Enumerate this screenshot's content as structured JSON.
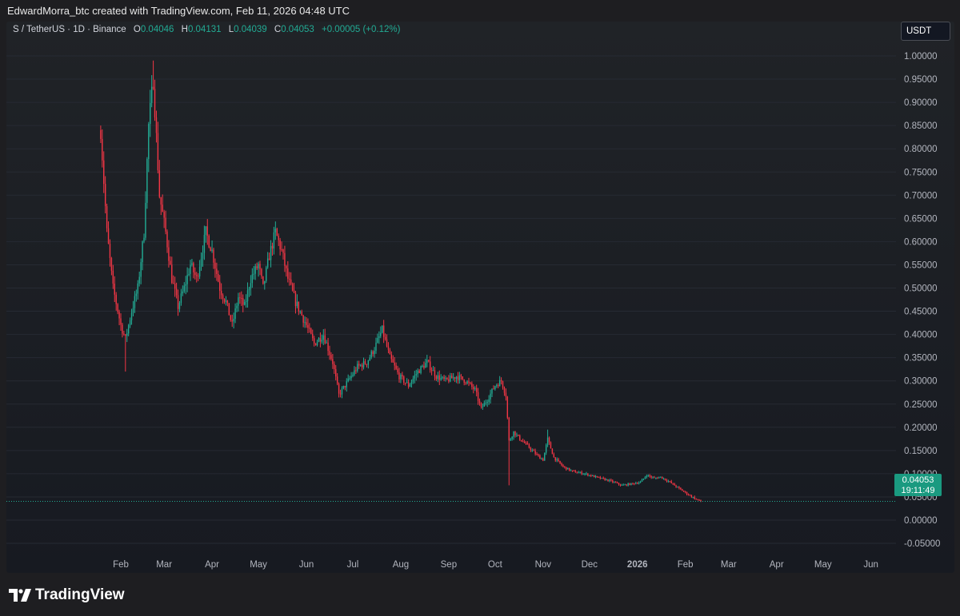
{
  "header": {
    "attribution": "EdwardMorra_btc created with TradingView.com, Feb 11, 2026 04:48 UTC"
  },
  "legend": {
    "symbol": "S / TetherUS · 1D · Binance",
    "open_label": "O",
    "open": "0.04046",
    "high_label": "H",
    "high": "0.04131",
    "low_label": "L",
    "low": "0.04039",
    "close_label": "C",
    "close": "0.04053",
    "change": "+0.00005 (+0.12%)"
  },
  "currency": "USDT",
  "last_price": {
    "price": "0.04053",
    "countdown": "19:11:49"
  },
  "footer": {
    "brand": "TradingView"
  },
  "colors": {
    "up": "#22ab94",
    "down": "#f23645",
    "axis_text": "#b2b5be"
  },
  "chart_data": {
    "type": "candlestick",
    "x_axis_labels": [
      "Feb",
      "Mar",
      "Apr",
      "May",
      "Jun",
      "Jul",
      "Aug",
      "Sep",
      "Oct",
      "Nov",
      "Dec",
      "2026",
      "Feb",
      "Mar",
      "Apr",
      "May",
      "Jun"
    ],
    "y_ticks": [
      1.0,
      0.95,
      0.9,
      0.85,
      0.8,
      0.75,
      0.7,
      0.65,
      0.6,
      0.55,
      0.5,
      0.45,
      0.4,
      0.35,
      0.3,
      0.25,
      0.2,
      0.15,
      0.1,
      0.05,
      0.0,
      -0.05
    ],
    "y_tick_labels": [
      "1.00000",
      "0.95000",
      "0.90000",
      "0.85000",
      "0.80000",
      "0.75000",
      "0.70000",
      "0.65000",
      "0.60000",
      "0.55000",
      "0.50000",
      "0.45000",
      "0.40000",
      "0.35000",
      "0.30000",
      "0.25000",
      "0.20000",
      "0.15000",
      "0.10000",
      "0.05000",
      "0.00000",
      "-0.05000"
    ],
    "ylim": [
      -0.07,
      1.06
    ],
    "last_close": 0.04053,
    "price_path": [
      [
        "2025-01-19",
        0.84
      ],
      [
        "2025-01-23",
        0.62
      ],
      [
        "2025-01-27",
        0.5
      ],
      [
        "2025-02-01",
        0.42
      ],
      [
        "2025-02-04",
        0.39
      ],
      [
        "2025-02-08",
        0.45
      ],
      [
        "2025-02-12",
        0.5
      ],
      [
        "2025-02-16",
        0.62
      ],
      [
        "2025-02-19",
        0.85
      ],
      [
        "2025-02-22",
        0.95
      ],
      [
        "2025-02-26",
        0.7
      ],
      [
        "2025-03-02",
        0.62
      ],
      [
        "2025-03-06",
        0.52
      ],
      [
        "2025-03-10",
        0.46
      ],
      [
        "2025-03-14",
        0.5
      ],
      [
        "2025-03-18",
        0.55
      ],
      [
        "2025-03-22",
        0.52
      ],
      [
        "2025-03-28",
        0.62
      ],
      [
        "2025-04-01",
        0.58
      ],
      [
        "2025-04-06",
        0.5
      ],
      [
        "2025-04-10",
        0.47
      ],
      [
        "2025-04-14",
        0.42
      ],
      [
        "2025-04-18",
        0.48
      ],
      [
        "2025-04-22",
        0.46
      ],
      [
        "2025-04-26",
        0.52
      ],
      [
        "2025-05-01",
        0.55
      ],
      [
        "2025-05-04",
        0.5
      ],
      [
        "2025-05-08",
        0.57
      ],
      [
        "2025-05-12",
        0.62
      ],
      [
        "2025-05-16",
        0.58
      ],
      [
        "2025-05-20",
        0.52
      ],
      [
        "2025-05-25",
        0.47
      ],
      [
        "2025-06-01",
        0.42
      ],
      [
        "2025-06-06",
        0.38
      ],
      [
        "2025-06-12",
        0.4
      ],
      [
        "2025-06-18",
        0.34
      ],
      [
        "2025-06-22",
        0.27
      ],
      [
        "2025-06-28",
        0.3
      ],
      [
        "2025-07-04",
        0.33
      ],
      [
        "2025-07-10",
        0.34
      ],
      [
        "2025-07-15",
        0.37
      ],
      [
        "2025-07-20",
        0.41
      ],
      [
        "2025-07-25",
        0.35
      ],
      [
        "2025-07-31",
        0.31
      ],
      [
        "2025-08-06",
        0.29
      ],
      [
        "2025-08-12",
        0.32
      ],
      [
        "2025-08-18",
        0.34
      ],
      [
        "2025-08-24",
        0.31
      ],
      [
        "2025-08-30",
        0.3
      ],
      [
        "2025-09-06",
        0.31
      ],
      [
        "2025-09-12",
        0.3
      ],
      [
        "2025-09-18",
        0.28
      ],
      [
        "2025-09-22",
        0.24
      ],
      [
        "2025-09-26",
        0.26
      ],
      [
        "2025-10-01",
        0.29
      ],
      [
        "2025-10-05",
        0.3
      ],
      [
        "2025-10-08",
        0.27
      ],
      [
        "2025-10-10",
        0.17
      ],
      [
        "2025-10-13",
        0.19
      ],
      [
        "2025-10-17",
        0.175
      ],
      [
        "2025-10-22",
        0.16
      ],
      [
        "2025-10-28",
        0.14
      ],
      [
        "2025-11-01",
        0.13
      ],
      [
        "2025-11-04",
        0.175
      ],
      [
        "2025-11-08",
        0.135
      ],
      [
        "2025-11-14",
        0.115
      ],
      [
        "2025-11-20",
        0.105
      ],
      [
        "2025-11-28",
        0.1
      ],
      [
        "2025-12-06",
        0.092
      ],
      [
        "2025-12-14",
        0.085
      ],
      [
        "2025-12-22",
        0.075
      ],
      [
        "2025-12-28",
        0.078
      ],
      [
        "2026-01-03",
        0.082
      ],
      [
        "2026-01-07",
        0.097
      ],
      [
        "2026-01-12",
        0.09
      ],
      [
        "2026-01-16",
        0.093
      ],
      [
        "2026-01-22",
        0.082
      ],
      [
        "2026-01-28",
        0.068
      ],
      [
        "2026-02-03",
        0.055
      ],
      [
        "2026-02-08",
        0.045
      ],
      [
        "2026-02-11",
        0.04053
      ]
    ],
    "extremes": [
      {
        "date": "2025-01-19",
        "high": 0.85
      },
      {
        "date": "2025-02-04",
        "low": 0.32
      },
      {
        "date": "2025-02-22",
        "high": 0.99
      },
      {
        "date": "2025-10-10",
        "low": 0.075
      },
      {
        "date": "2025-11-04",
        "high": 0.195
      }
    ]
  }
}
